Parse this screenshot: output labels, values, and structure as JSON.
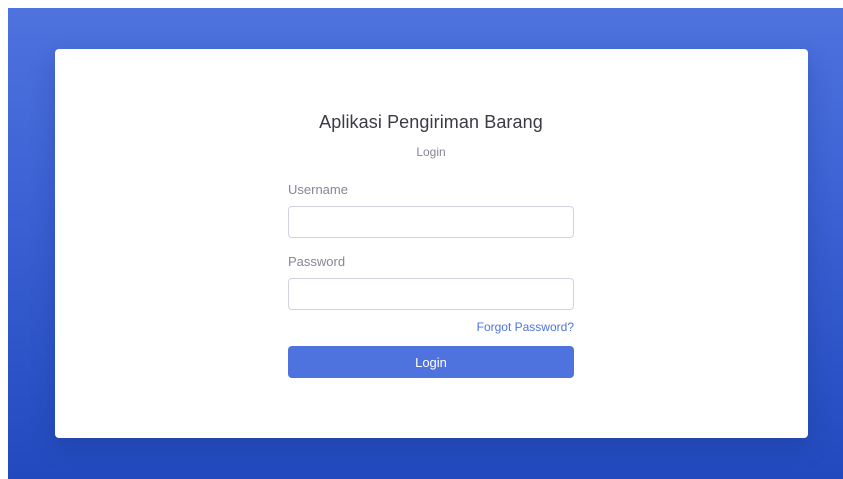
{
  "login_card": {
    "title": "Aplikasi Pengiriman Barang",
    "subtitle": "Login",
    "username_label": "Username",
    "username_value": "",
    "password_label": "Password",
    "password_value": "",
    "forgot_link": "Forgot Password?",
    "submit_label": "Login"
  },
  "theme": {
    "background_gradient_top": "#4e73df",
    "background_gradient_bottom": "#224abe",
    "accent": "#4e73df"
  }
}
